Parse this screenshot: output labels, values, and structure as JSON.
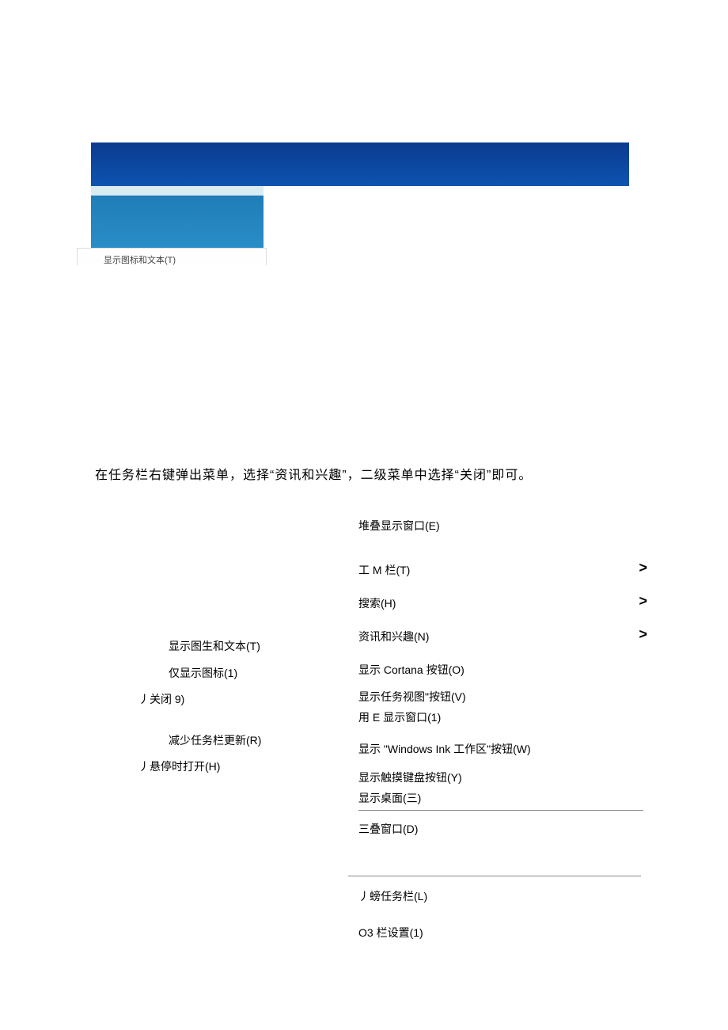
{
  "image": {
    "popup_hint": "显示图标和文本(T)"
  },
  "instruction": "在任务栏右键弹出菜单，选择“资讯和兴趣”，二级菜单中选择“关闭”即可。",
  "submenu": {
    "show_icon_text": "显示图生和文本(T)",
    "show_icon_only": "仅显示图标(1)",
    "close": "丿关闭 9)",
    "reduce_updates": "减少任务栏更新(R)",
    "open_hover": "丿悬停时打开(H)"
  },
  "mainmenu": {
    "cascade": "堆叠显示窗口(E)",
    "toolbar": "工 M 栏(T)",
    "search": "搜索(H)",
    "news": "资讯和兴趣(N)",
    "cortana": "显示 Cortana 按钮(O)",
    "taskview": "显示任务视图\"按钮(V)",
    "show_e_window": "用 E 显示窗口(1)",
    "ink": "显示 \"Windows Ink 工作区\"按钮(W)",
    "touch_kb": "显示触摸键盘按钮(Y)",
    "desktop": "显示桌面(三)",
    "stack_d": "三叠窗口(D)",
    "lock_taskbar": "丿螃任务栏(L)",
    "settings": "O3 栏设置(1)"
  },
  "glyphs": {
    "chevron": ">"
  }
}
